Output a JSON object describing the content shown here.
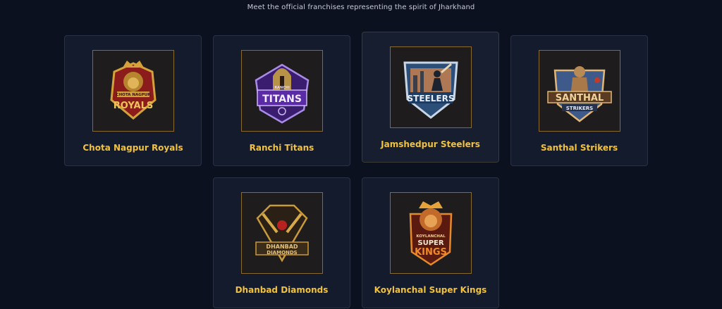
{
  "header": {
    "subtitle": "Meet the official franchises representing the spirit of Jharkhand"
  },
  "teams": [
    {
      "name": "Chota Nagpur Royals",
      "logo_icon": "lion-crest-icon",
      "logo_text_top": "CHOTA NAGPUR",
      "logo_text_main": "ROYALS",
      "accent": "#d4a23a",
      "secondary": "#8c1b1b"
    },
    {
      "name": "Ranchi Titans",
      "logo_icon": "spartan-helmet-icon",
      "logo_text_top": "RANCHI",
      "logo_text_main": "TITANS",
      "accent": "#a98be8",
      "secondary": "#5b2aa6"
    },
    {
      "name": "Jamshedpur Steelers",
      "logo_icon": "batsman-shield-icon",
      "logo_text_top": "",
      "logo_text_main": "STEELERS",
      "accent": "#c9d6e6",
      "secondary": "#2c4f7a"
    },
    {
      "name": "Santhal Strikers",
      "logo_icon": "warrior-crest-icon",
      "logo_text_top": "",
      "logo_text_main": "SANTHAL",
      "logo_text_sub": "STRIKERS",
      "accent": "#e0b778",
      "secondary": "#3d5a8a"
    },
    {
      "name": "Dhanbad Diamonds",
      "logo_icon": "diamond-bats-icon",
      "logo_text_top": "",
      "logo_text_main": "DHANBAD",
      "logo_text_sub": "DIAMONDS",
      "accent": "#c99a3b",
      "secondary": "#2a2016"
    },
    {
      "name": "Koylanchal Super Kings",
      "logo_icon": "lion-king-icon",
      "logo_text_top": "KOYLANCHAL",
      "logo_text_main": "SUPER",
      "logo_text_sub": "KINGS",
      "accent": "#e58a2a",
      "secondary": "#5a1a10"
    }
  ]
}
